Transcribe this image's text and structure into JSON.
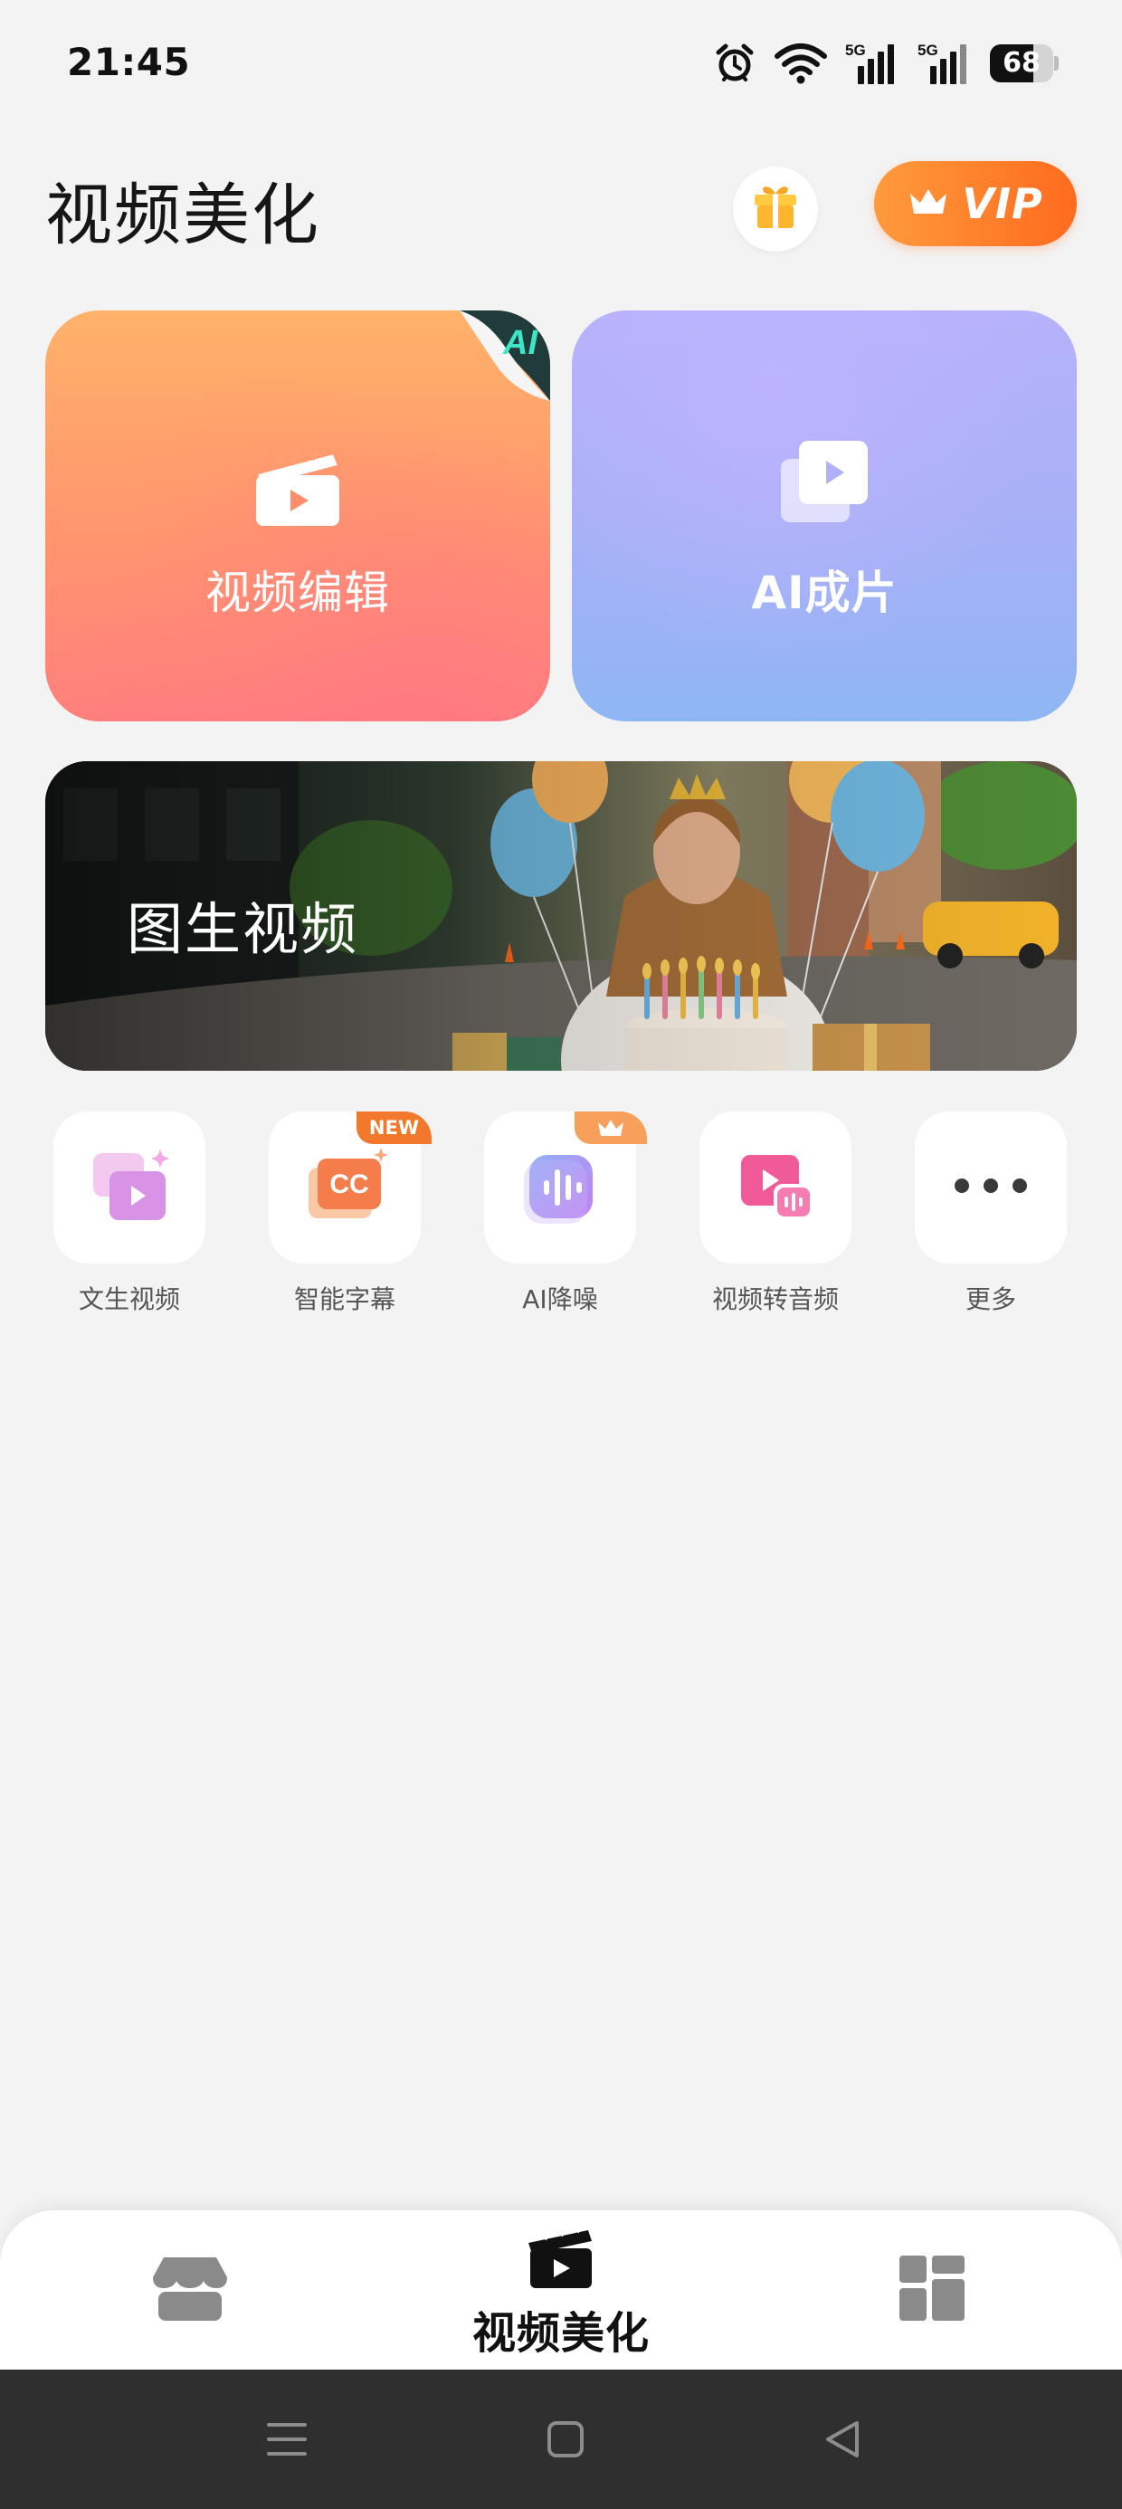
{
  "status_bar": {
    "time": "21:45",
    "battery_level": "68",
    "battery_fraction": 0.68,
    "signal_labels": [
      "5G",
      "5G"
    ]
  },
  "header": {
    "title": "视频美化",
    "vip_label": "VIP"
  },
  "feature_cards": [
    {
      "label": "视频编辑",
      "corner_badge": "AI"
    },
    {
      "label": "AI成片"
    }
  ],
  "banner": {
    "label": "图生视频"
  },
  "tools": [
    {
      "label": "文生视频"
    },
    {
      "label": "智能字幕",
      "badge": "NEW",
      "icon_text": "CC"
    },
    {
      "label": "AI降噪",
      "badge_icon": "crown-icon"
    },
    {
      "label": "视频转音频"
    },
    {
      "label": "更多"
    }
  ],
  "bottom_nav": {
    "active_label": "视频美化"
  },
  "colors": {
    "vip_gradient_start": "#ff9a3c",
    "vip_gradient_end": "#ff6b1e",
    "card_edit_top": "#ffb26a",
    "card_edit_bottom": "#ff7f7d",
    "card_ai_top": "#b6b2fb",
    "card_ai_bottom": "#8fb6f4",
    "new_badge": "#f2782b",
    "page_background": "#f3f3f3"
  }
}
